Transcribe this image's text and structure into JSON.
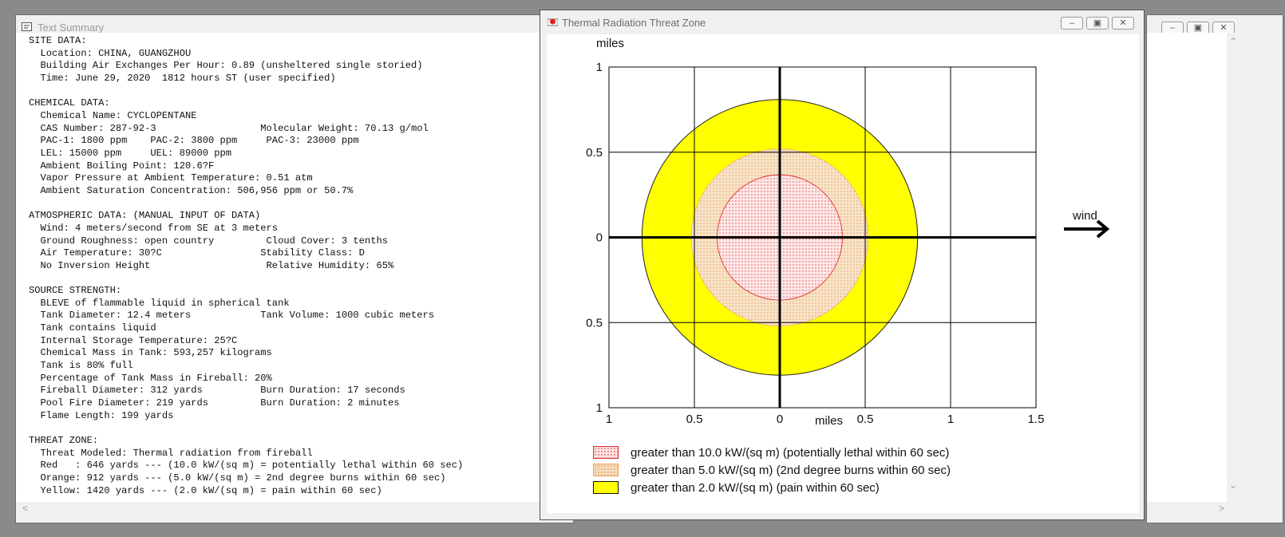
{
  "text_summary": {
    "title": "Text Summary",
    "lines": [
      "SITE DATA:",
      "  Location: CHINA, GUANGZHOU",
      "  Building Air Exchanges Per Hour: 0.89 (unsheltered single storied)",
      "  Time: June 29, 2020  1812 hours ST (user specified)",
      "",
      "CHEMICAL DATA:",
      "  Chemical Name: CYCLOPENTANE",
      "  CAS Number: 287-92-3                  Molecular Weight: 70.13 g/mol",
      "  PAC-1: 1800 ppm    PAC-2: 3800 ppm     PAC-3: 23000 ppm",
      "  LEL: 15000 ppm     UEL: 89000 ppm",
      "  Ambient Boiling Point: 120.6?F",
      "  Vapor Pressure at Ambient Temperature: 0.51 atm",
      "  Ambient Saturation Concentration: 506,956 ppm or 50.7%",
      "",
      "ATMOSPHERIC DATA: (MANUAL INPUT OF DATA)",
      "  Wind: 4 meters/second from SE at 3 meters",
      "  Ground Roughness: open country         Cloud Cover: 3 tenths",
      "  Air Temperature: 30?C                 Stability Class: D",
      "  No Inversion Height                    Relative Humidity: 65%",
      "",
      "SOURCE STRENGTH:",
      "  BLEVE of flammable liquid in spherical tank",
      "  Tank Diameter: 12.4 meters            Tank Volume: 1000 cubic meters",
      "  Tank contains liquid",
      "  Internal Storage Temperature: 25?C",
      "  Chemical Mass in Tank: 593,257 kilograms",
      "  Tank is 80% full",
      "  Percentage of Tank Mass in Fireball: 20%",
      "  Fireball Diameter: 312 yards          Burn Duration: 17 seconds",
      "  Pool Fire Diameter: 219 yards         Burn Duration: 2 minutes",
      "  Flame Length: 199 yards",
      "",
      "THREAT ZONE:",
      "  Threat Modeled: Thermal radiation from fireball",
      "  Red   : 646 yards --- (10.0 kW/(sq m) = potentially lethal within 60 sec)",
      "  Orange: 912 yards --- (5.0 kW/(sq m) = 2nd degree burns within 60 sec)",
      "  Yellow: 1420 yards --- (2.0 kW/(sq m) = pain within 60 sec)"
    ]
  },
  "threat_window": {
    "title": "Thermal Radiation Threat Zone",
    "wind_label": "wind"
  },
  "chart_data": {
    "type": "scatter",
    "title": "",
    "xlabel": "miles",
    "ylabel": "miles",
    "xlim": [
      -1,
      1.5
    ],
    "ylim": [
      -1,
      1
    ],
    "x_ticks": [
      -1,
      -0.5,
      0,
      0.5,
      1,
      1.5
    ],
    "y_ticks": [
      1,
      0.5,
      0,
      -0.5,
      -1
    ],
    "x_tick_labels": [
      "1",
      "0.5",
      "0",
      "0.5",
      "1",
      "1.5"
    ],
    "y_tick_labels": [
      "1",
      "0.5",
      "0",
      "0.5",
      "1"
    ],
    "grid": true,
    "zones": [
      {
        "name": "greater than 2.0 kW/(sq m) (pain within 60 sec)",
        "radius_miles": 0.807,
        "color": "#ffff00",
        "pattern": "solid"
      },
      {
        "name": "greater than 5.0 kW/(sq m) (2nd degree burns within 60 sec)",
        "radius_miles": 0.518,
        "color": "#f5dcc0",
        "pattern": "dots-orange"
      },
      {
        "name": "greater than 10.0 kW/(sq m) (potentially lethal within 60 sec)",
        "radius_miles": 0.367,
        "color": "#fbe3e3",
        "pattern": "dots-red"
      }
    ]
  },
  "legend": [
    {
      "label": "greater than 10.0 kW/(sq m) (potentially lethal within 60 sec)",
      "color": "#fbe3e3",
      "border": "#e03030"
    },
    {
      "label": "greater than 5.0 kW/(sq m) (2nd degree burns within 60 sec)",
      "color": "#f5dcc0",
      "border": "#f0a050"
    },
    {
      "label": "greater than 2.0 kW/(sq m) (pain within 60 sec)",
      "color": "#ffff00",
      "border": "#111111"
    }
  ]
}
